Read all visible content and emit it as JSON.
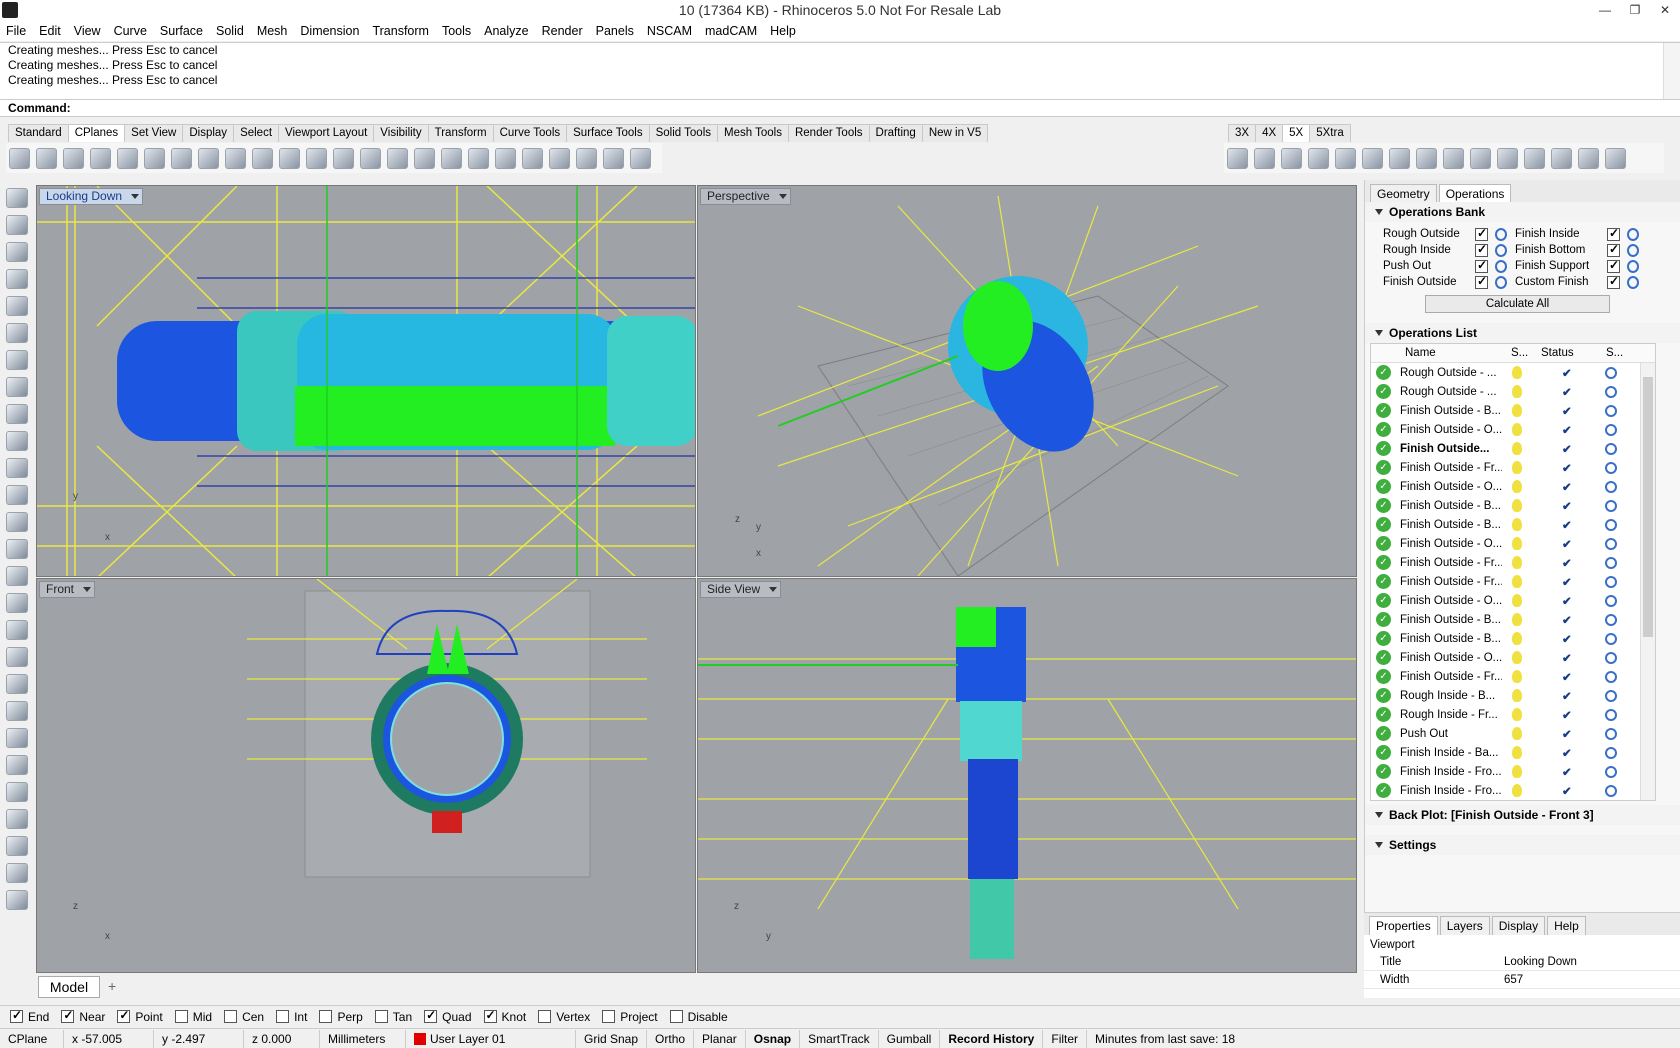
{
  "window": {
    "title": "10 (17364 KB) - Rhinoceros 5.0 Not For Resale Lab",
    "min": "—",
    "max": "❐",
    "close": "✕"
  },
  "menu": [
    "File",
    "Edit",
    "View",
    "Curve",
    "Surface",
    "Solid",
    "Mesh",
    "Dimension",
    "Transform",
    "Tools",
    "Analyze",
    "Render",
    "Panels",
    "NSCAM",
    "madCAM",
    "Help"
  ],
  "history": [
    "Creating meshes... Press Esc to cancel",
    "Creating meshes... Press Esc to cancel",
    "Creating meshes... Press Esc to cancel"
  ],
  "command_label": "Command:",
  "toolbar_tabs": [
    "Standard",
    "CPlanes",
    "Set View",
    "Display",
    "Select",
    "Viewport Layout",
    "Visibility",
    "Transform",
    "Curve Tools",
    "Surface Tools",
    "Solid Tools",
    "Mesh Tools",
    "Render Tools",
    "Drafting",
    "New in V5"
  ],
  "active_tab": "CPlanes",
  "right_tabs": [
    "3X",
    "4X",
    "5X",
    "5Xtra"
  ],
  "viewports": {
    "top": {
      "label": "Looking Down",
      "ax1": "y",
      "ax2": "x"
    },
    "persp": {
      "label": "Perspective",
      "ax1": "z",
      "ax2": "y",
      "ax3": "x"
    },
    "front": {
      "label": "Front",
      "ax1": "z",
      "ax2": "x"
    },
    "side": {
      "label": "Side View",
      "ax1": "z",
      "ax2": "y"
    }
  },
  "panel": {
    "tabs": [
      "Geometry",
      "Operations"
    ],
    "bank_title": "Operations Bank",
    "bank": [
      {
        "a": "Rough Outside",
        "b": "Finish Inside"
      },
      {
        "a": "Rough Inside",
        "b": "Finish Bottom"
      },
      {
        "a": "Push Out",
        "b": "Finish Support"
      },
      {
        "a": "Finish Outside",
        "b": "Custom Finish"
      }
    ],
    "calc": "Calculate All",
    "list_title": "Operations List",
    "cols": {
      "name": "Name",
      "s": "S...",
      "status": "Status",
      "s2": "S..."
    },
    "ops": [
      "Rough Outside - ...",
      "Rough Outside - ...",
      "Finish Outside - B...",
      "Finish Outside - O...",
      "Finish Outside...",
      "Finish Outside - Fr...",
      "Finish Outside - O...",
      "Finish Outside - B...",
      "Finish Outside - B...",
      "Finish Outside - O...",
      "Finish Outside - Fr...",
      "Finish Outside - Fr...",
      "Finish Outside - O...",
      "Finish Outside - B...",
      "Finish Outside - B...",
      "Finish Outside - O...",
      "Finish Outside - Fr...",
      "Rough Inside - B...",
      "Rough Inside - Fr...",
      "Push Out",
      "Finish Inside - Ba...",
      "Finish Inside - Fro...",
      "Finish Inside - Fro..."
    ],
    "backplot": "Back Plot: [Finish Outside - Front 3]",
    "settings": "Settings"
  },
  "props": {
    "tabs": [
      "Properties",
      "Layers",
      "Display",
      "Help"
    ],
    "section": "Viewport",
    "rows": [
      {
        "k": "Title",
        "v": "Looking Down"
      },
      {
        "k": "Width",
        "v": "657"
      }
    ]
  },
  "model_tab": "Model",
  "osnaps": [
    {
      "label": "End",
      "on": true
    },
    {
      "label": "Near",
      "on": true
    },
    {
      "label": "Point",
      "on": true
    },
    {
      "label": "Mid",
      "on": false
    },
    {
      "label": "Cen",
      "on": false
    },
    {
      "label": "Int",
      "on": false
    },
    {
      "label": "Perp",
      "on": false
    },
    {
      "label": "Tan",
      "on": false
    },
    {
      "label": "Quad",
      "on": true
    },
    {
      "label": "Knot",
      "on": true
    },
    {
      "label": "Vertex",
      "on": false
    },
    {
      "label": "Project",
      "on": false
    },
    {
      "label": "Disable",
      "on": false
    }
  ],
  "status": {
    "cplane": "CPlane",
    "x": "x -57.005",
    "y": "y -2.497",
    "z": "z 0.000",
    "units": "Millimeters",
    "layer": "User Layer 01",
    "grid": "Grid Snap",
    "ortho": "Ortho",
    "planar": "Planar",
    "osnap": "Osnap",
    "smart": "SmartTrack",
    "gumball": "Gumball",
    "history": "Record History",
    "filter": "Filter",
    "saved": "Minutes from last save: 18"
  }
}
